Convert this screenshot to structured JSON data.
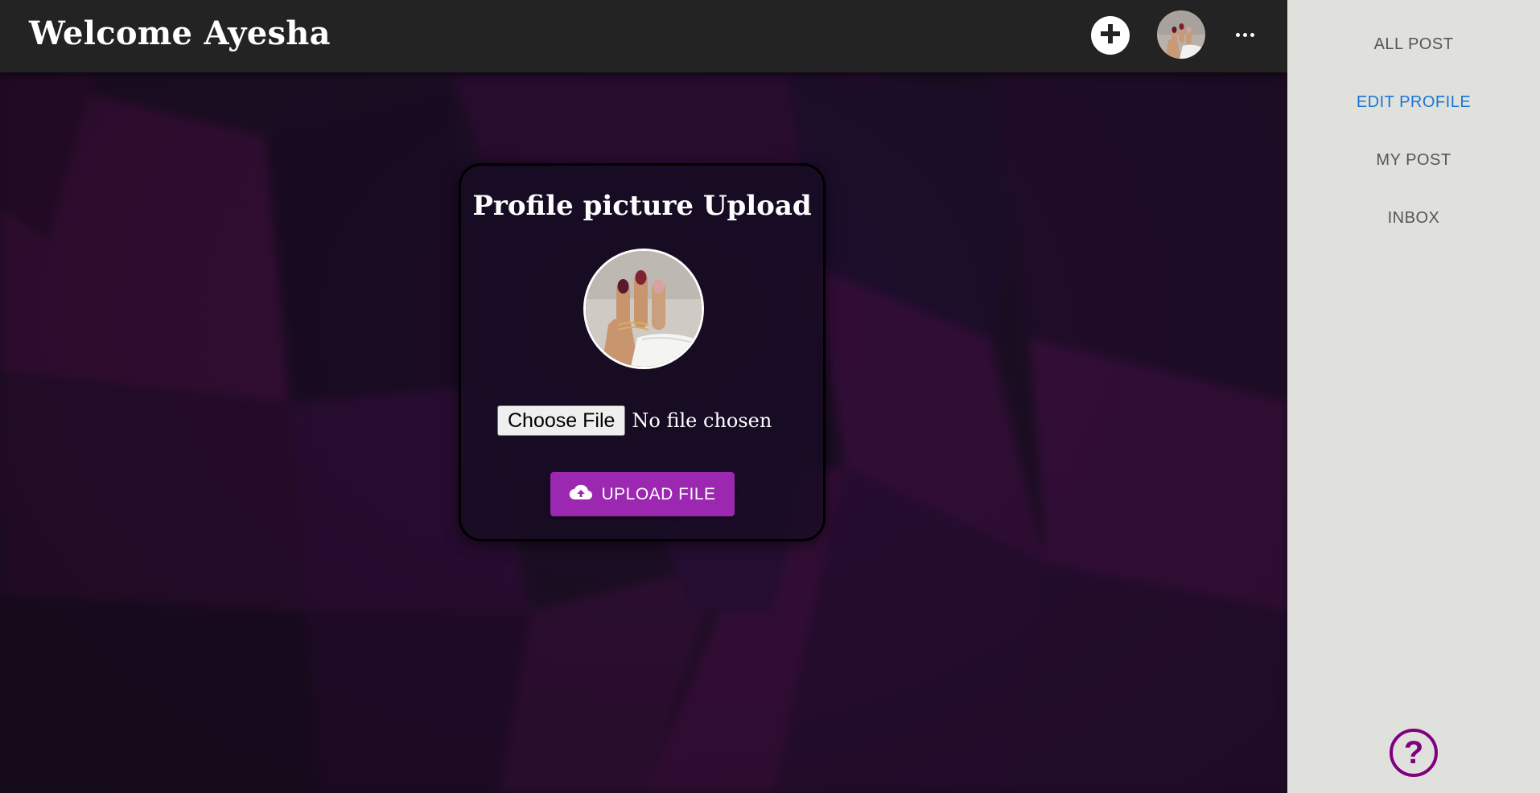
{
  "header": {
    "title": "Welcome Ayesha",
    "add_icon": "plus-circle-icon",
    "avatar_alt": "user avatar",
    "more_icon": "more-horizontal-icon"
  },
  "card": {
    "title": "Profile picture Upload",
    "file_input": {
      "button_label": "Choose File",
      "status": "No file chosen"
    },
    "upload_button": {
      "label": "UPLOAD FILE",
      "icon": "cloud-upload-icon",
      "color": "#9c27b0"
    }
  },
  "stray_text": ";",
  "sidebar": {
    "items": [
      {
        "label": "ALL POST",
        "active": false
      },
      {
        "label": "EDIT PROFILE",
        "active": true
      },
      {
        "label": "MY POST",
        "active": false
      },
      {
        "label": "INBOX",
        "active": false
      }
    ],
    "active_color": "#1976d2",
    "help_icon": "question-circle-icon",
    "help_color": "#800080"
  }
}
